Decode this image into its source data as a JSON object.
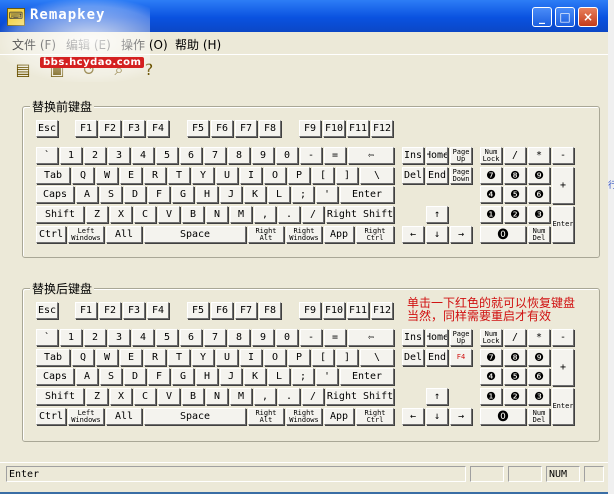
{
  "window": {
    "title": "Remapkey",
    "app_icon": "keyboard-app-icon"
  },
  "window_buttons": {
    "minimize": "_",
    "maximize": "□",
    "close": "×"
  },
  "menu": [
    "文件 (F)",
    "编辑 (E)",
    "操作 (O)",
    "帮助 (H)"
  ],
  "toolbar": [
    "open-file-icon",
    "save-icon",
    "reset-icon",
    "find-icon",
    "help-icon"
  ],
  "watermark": {
    "url": "bbs.hcydao.com"
  },
  "groups": {
    "before": "替换前键盘",
    "after": "替换后键盘"
  },
  "keys": {
    "esc": "Esc",
    "f1": "F1",
    "f2": "F2",
    "f3": "F3",
    "f4": "F4",
    "f5": "F5",
    "f6": "F6",
    "f7": "F7",
    "f8": "F8",
    "f9": "F9",
    "f10": "F10",
    "f11": "F11",
    "f12": "F12",
    "backtick": "`",
    "n1": "1",
    "n2": "2",
    "n3": "3",
    "n4": "4",
    "n5": "5",
    "n6": "6",
    "n7": "7",
    "n8": "8",
    "n9": "9",
    "n0": "0",
    "minus": "-",
    "equals": "=",
    "backspace": "⇦",
    "tab": "Tab",
    "q": "Q",
    "w": "W",
    "e": "E",
    "r": "R",
    "t": "T",
    "y": "Y",
    "u": "U",
    "i": "I",
    "o": "O",
    "p": "P",
    "lbracket": "[",
    "rbracket": "]",
    "backslash": "\\",
    "caps": "Caps",
    "a": "A",
    "s": "S",
    "d": "D",
    "f": "F",
    "g": "G",
    "h": "H",
    "j": "J",
    "k": "K",
    "l": "L",
    "semicolon": ";",
    "quote": "'",
    "enter": "Enter",
    "lshift": "Shift",
    "z": "Z",
    "x": "X",
    "c": "C",
    "v": "V",
    "b": "B",
    "n": "N",
    "m": "M",
    "comma": ",",
    "period": ".",
    "slash": "/",
    "rshift": "Right Shift",
    "lctrl": "Ctrl",
    "lwin": "Left Windows",
    "alt": "All",
    "space": "Space",
    "ralt": "Right Alt",
    "rwin": "Right Windows",
    "app": "App",
    "rctrl": "Right Ctrl",
    "ins": "Ins",
    "home": "Home",
    "pgup": "Page Up",
    "del": "Del",
    "end": "End",
    "pgdn": "Page Down",
    "up": "↑",
    "left": "←",
    "down": "↓",
    "right": "→",
    "numlock": "Num Lock",
    "numdiv": "/",
    "nummul": "*",
    "numsub": "-",
    "numadd": "+",
    "np7": "❼",
    "np8": "❽",
    "np9": "❾",
    "np4": "❹",
    "np5": "❺",
    "np6": "❻",
    "np1": "❶",
    "np2": "❷",
    "np3": "❸",
    "np0": "⓿",
    "numdel": "Num Del",
    "numenter": "Enter"
  },
  "remapped": {
    "pgdn": "F4"
  },
  "remap_note": [
    "单击一下红色的就可以恢复键盘",
    "当然，同样需要重启才有效"
  ],
  "status": {
    "main": "Enter",
    "num": "NUM"
  },
  "background_window": {
    "fragment": "行"
  }
}
